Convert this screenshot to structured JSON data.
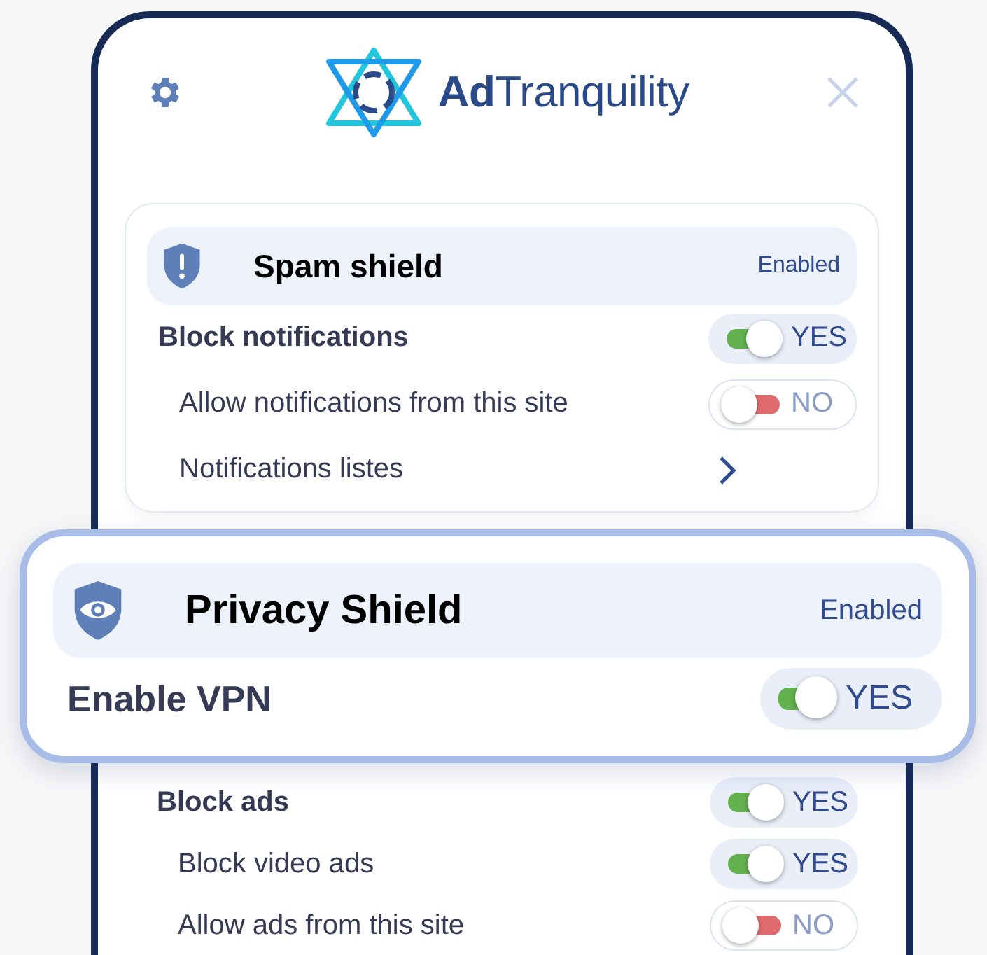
{
  "header": {
    "logo": "**Ad**Tranquility"
  },
  "spam_shield": {
    "title": "Spam shield",
    "status": "Enabled",
    "rows": [
      {
        "label": "Block notifications",
        "kind": "toggle",
        "on": true,
        "value": "YES",
        "children": [
          {
            "label": "Allow notifications from this site",
            "kind": "toggle",
            "on": false,
            "value": "NO"
          },
          {
            "label": "Notifications listes",
            "kind": "link"
          }
        ]
      }
    ]
  },
  "privacy_shield": {
    "title": "Privacy Shield",
    "status": "Enabled",
    "rows": [
      {
        "label": "Enable VPN",
        "kind": "toggle",
        "on": true,
        "value": "YES"
      }
    ]
  },
  "privacy_rows": [
    {
      "label": "Block ads",
      "kind": "toggle",
      "on": true,
      "value": "YES",
      "children": [
        {
          "label": "Block video ads",
          "kind": "toggle",
          "on": true,
          "value": "YES"
        },
        {
          "label": "Allow ads from this site",
          "kind": "toggle",
          "on": false,
          "value": "NO"
        }
      ]
    }
  ]
}
